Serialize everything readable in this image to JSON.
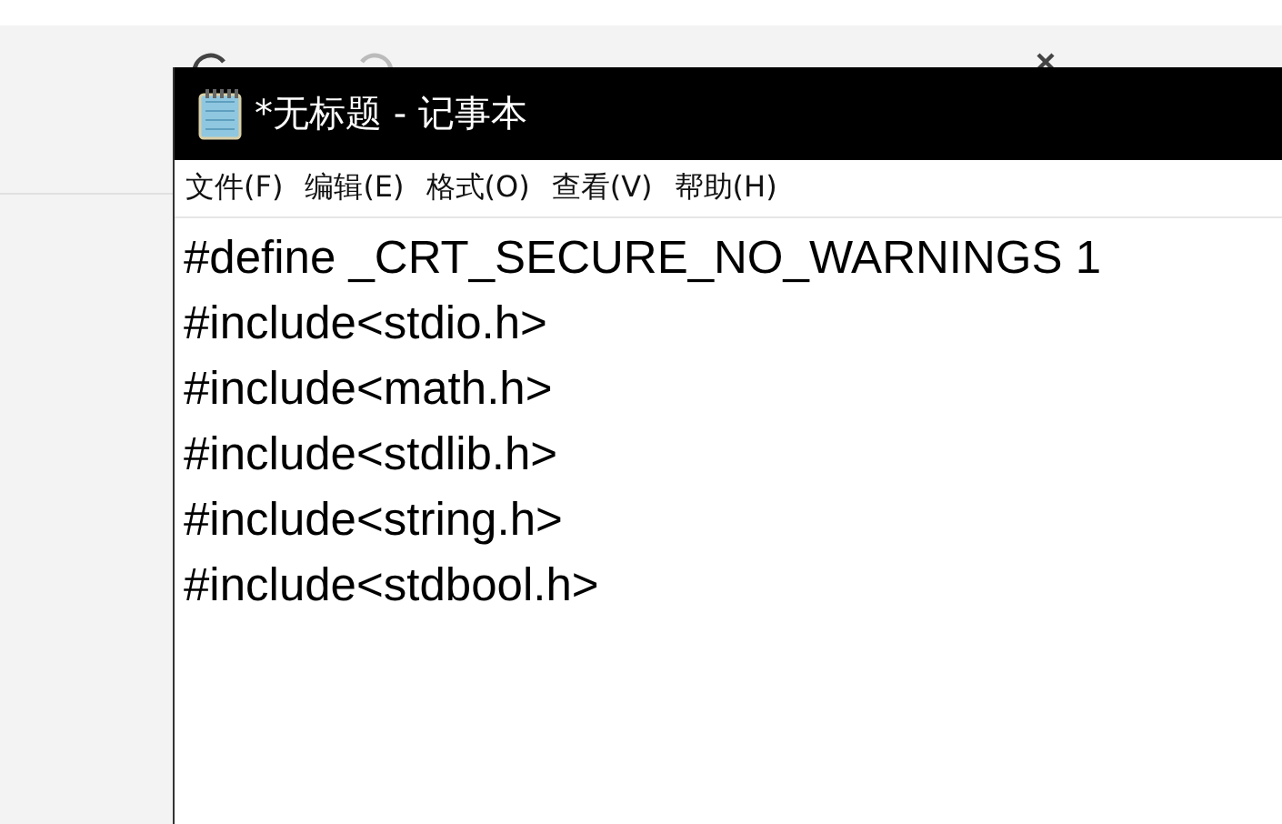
{
  "window": {
    "title": "*无标题 - 记事本"
  },
  "menu": [
    "文件(F)",
    "编辑(E)",
    "格式(O)",
    "查看(V)",
    "帮助(H)"
  ],
  "editor": {
    "lines": [
      "#define _CRT_SECURE_NO_WARNINGS 1",
      "#include<stdio.h>",
      "#include<math.h>",
      "#include<stdlib.h>",
      "#include<string.h>",
      "#include<stdbool.h>"
    ]
  }
}
